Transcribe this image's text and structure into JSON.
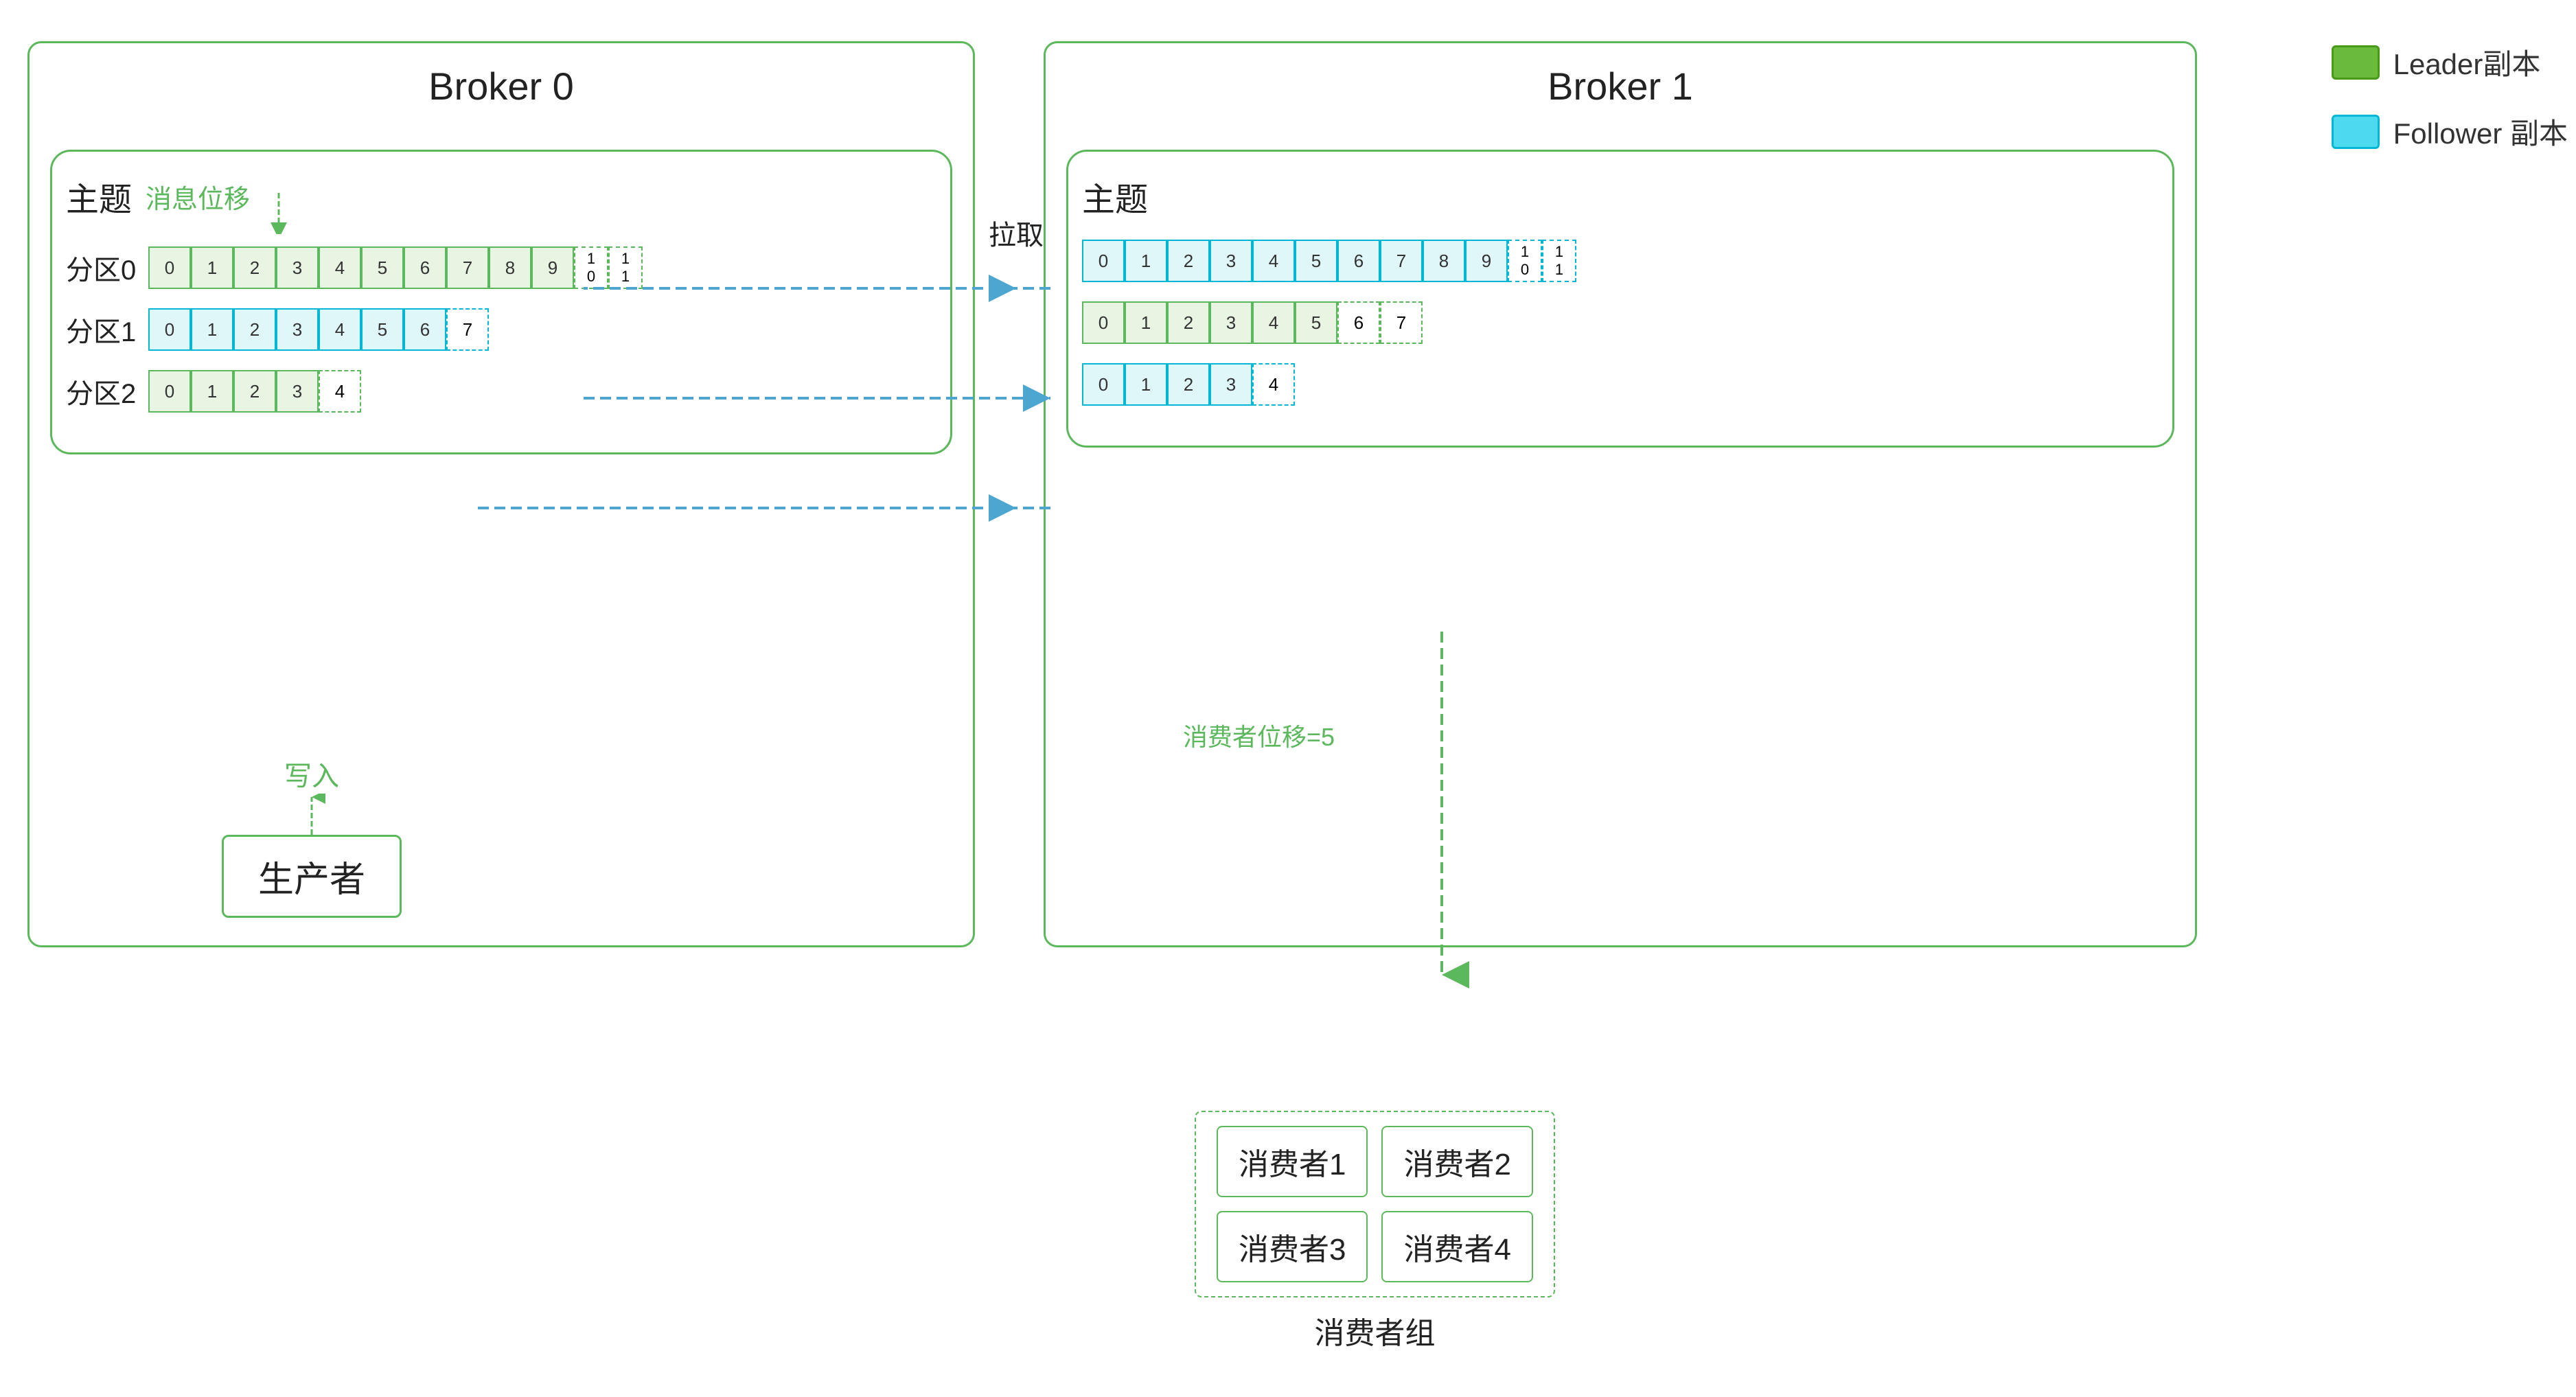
{
  "legend": {
    "leader_label": "Leader副本",
    "follower_label": "Follower 副本"
  },
  "broker0": {
    "title": "Broker 0",
    "topic_label": "主题",
    "offset_label": "消息位移",
    "partitions": [
      {
        "label": "分区0",
        "cells": [
          "0",
          "1",
          "2",
          "3",
          "4",
          "5",
          "6",
          "7",
          "8",
          "9"
        ],
        "extra": [
          "1\n0",
          "1\n1"
        ],
        "type": "green"
      },
      {
        "label": "分区1",
        "cells": [
          "0",
          "1",
          "2",
          "3",
          "4",
          "5",
          "6",
          "7"
        ],
        "type": "blue"
      },
      {
        "label": "分区2",
        "cells": [
          "0",
          "1",
          "2",
          "3",
          "4"
        ],
        "type": "green"
      }
    ]
  },
  "broker1": {
    "title": "Broker 1",
    "topic_label": "主题",
    "partitions": [
      {
        "label": "",
        "cells": [
          "0",
          "1",
          "2",
          "3",
          "4",
          "5",
          "6",
          "7",
          "8",
          "9"
        ],
        "extra": [
          "1\n0",
          "1\n1"
        ],
        "type": "blue"
      },
      {
        "label": "",
        "cells": [
          "0",
          "1",
          "2",
          "3",
          "4",
          "5",
          "6",
          "7"
        ],
        "type": "green"
      },
      {
        "label": "",
        "cells": [
          "0",
          "1",
          "2",
          "3",
          "4"
        ],
        "type": "blue"
      }
    ]
  },
  "labels": {
    "pull": "拉取",
    "write": "写入",
    "producer": "生产者",
    "consumer_offset": "消费者位移=5",
    "consumer_group": "消费者组",
    "consumers": [
      "消费者1",
      "消费者2",
      "消费者3",
      "消费者4"
    ]
  }
}
